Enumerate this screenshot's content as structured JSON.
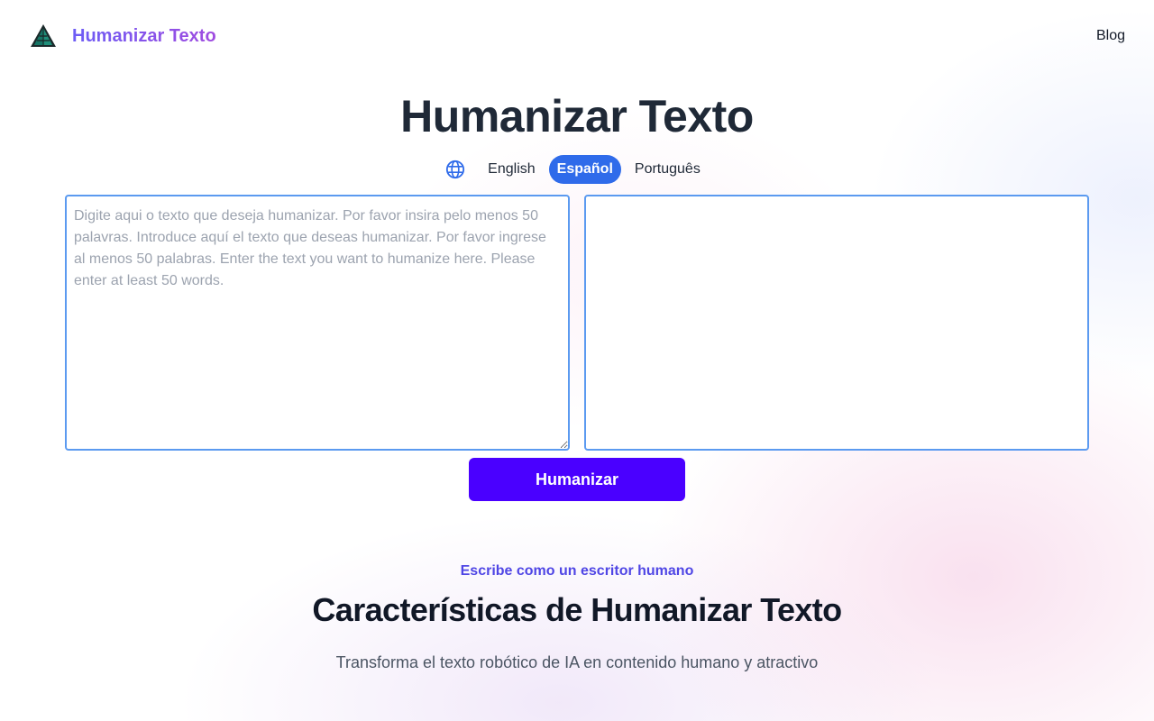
{
  "header": {
    "brand_name": "Humanizar Texto",
    "brand_logo": "pyramid-logo",
    "nav_blog": "Blog"
  },
  "hero": {
    "title": "Humanizar Texto",
    "language_icon": "globe-icon",
    "languages": [
      {
        "label": "English",
        "active": false
      },
      {
        "label": "Español",
        "active": true
      },
      {
        "label": "Português",
        "active": false
      }
    ]
  },
  "editor": {
    "input_value": "",
    "input_placeholder": "Digite aqui o texto que deseja humanizar. Por favor insira pelo menos 50 palavras. Introduce aquí el texto que deseas humanizar. Por favor ingrese al menos 50 palabras. Enter the text you want to humanize here. Please enter at least 50 words.",
    "output_value": ""
  },
  "actions": {
    "humanize_label": "Humanizar"
  },
  "features": {
    "eyebrow": "Escribe como un escritor humano",
    "title": "Características de Humanizar Texto",
    "subtitle": "Transforma el texto robótico de IA en contenido humano y atractivo"
  },
  "colors": {
    "brand_gradient_start": "#6d5df5",
    "brand_gradient_end": "#a04ce0",
    "active_language": "#2f6bea",
    "primary_button": "#4a00ff",
    "editor_border": "#5b9af0",
    "eyebrow": "#4f46e5"
  }
}
